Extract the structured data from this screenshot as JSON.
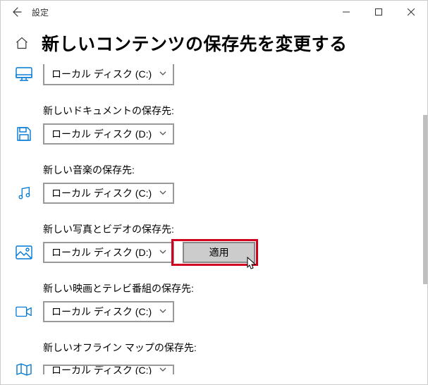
{
  "titlebar": {
    "title": "設定"
  },
  "page": {
    "heading": "新しいコンテンツの保存先を変更する"
  },
  "options": {
    "local_c": "ローカル ディスク (C:)",
    "local_d": "ローカル ディスク (D:)"
  },
  "section_apps": {
    "value_key": "options.local_c"
  },
  "section_docs": {
    "label": "新しいドキュメントの保存先:",
    "value_key": "options.local_d"
  },
  "section_music": {
    "label": "新しい音楽の保存先:",
    "value_key": "options.local_c"
  },
  "section_photos": {
    "label": "新しい写真とビデオの保存先:",
    "value_key": "options.local_d",
    "apply_label": "適用"
  },
  "section_movies": {
    "label": "新しい映画とテレビ番組の保存先:",
    "value_key": "options.local_c"
  },
  "section_maps": {
    "label": "新しいオフライン マップの保存先:",
    "value_key": "options.local_c"
  }
}
